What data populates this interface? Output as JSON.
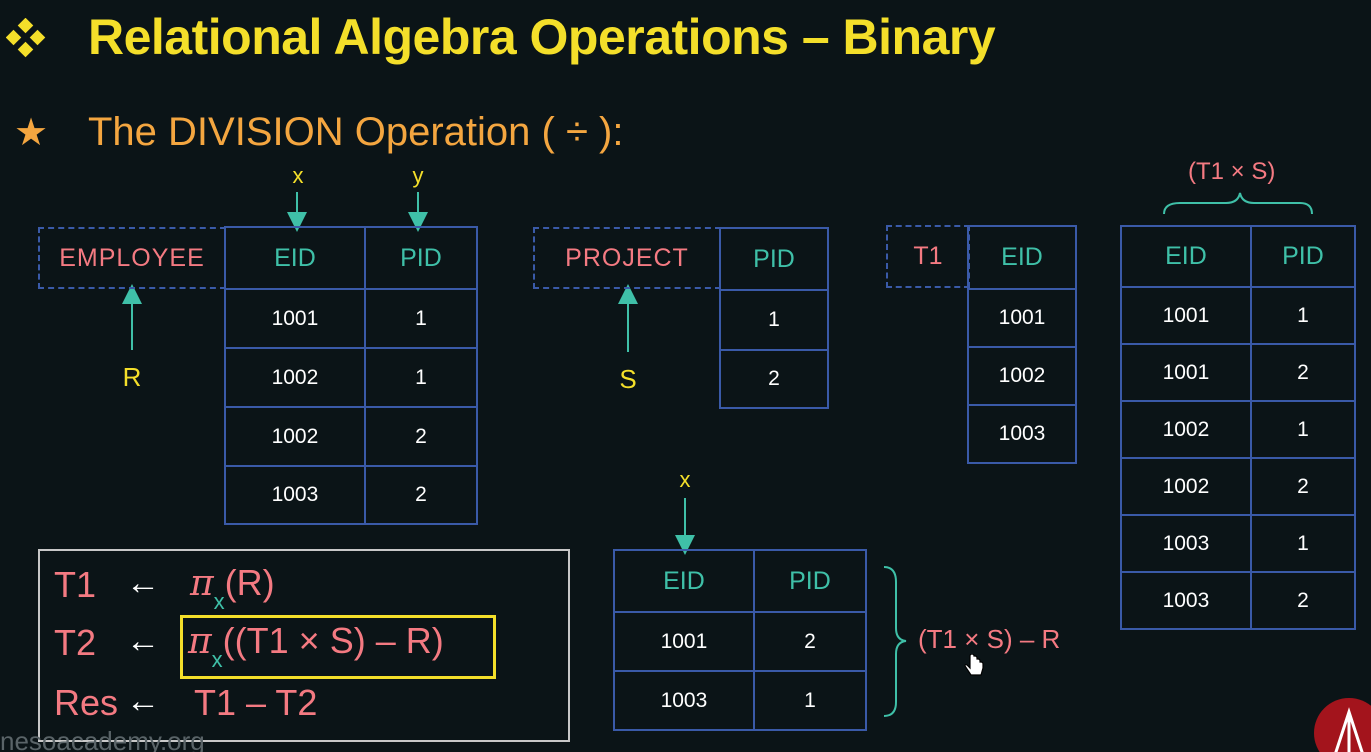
{
  "title": "Relational Algebra Operations – Binary",
  "subtitle": "The DIVISION Operation ( ÷ ):",
  "labels": {
    "x_top": "x",
    "y_top": "y",
    "r": "R",
    "s": "S",
    "x_result": "x",
    "t1xs": "(T1 × S)"
  },
  "employee": {
    "name": "EMPLOYEE",
    "headers": [
      "EID",
      "PID"
    ],
    "rows": [
      [
        "1001",
        "1"
      ],
      [
        "1002",
        "1"
      ],
      [
        "1002",
        "2"
      ],
      [
        "1003",
        "2"
      ]
    ]
  },
  "project": {
    "name": "PROJECT",
    "headers": [
      "PID"
    ],
    "rows": [
      [
        "1"
      ],
      [
        "2"
      ]
    ]
  },
  "t1": {
    "name": "T1",
    "headers": [
      "EID"
    ],
    "rows": [
      [
        "1001"
      ],
      [
        "1002"
      ],
      [
        "1003"
      ]
    ]
  },
  "t1xs_table": {
    "headers": [
      "EID",
      "PID"
    ],
    "rows": [
      [
        "1001",
        "1"
      ],
      [
        "1001",
        "2"
      ],
      [
        "1002",
        "1"
      ],
      [
        "1002",
        "2"
      ],
      [
        "1003",
        "1"
      ],
      [
        "1003",
        "2"
      ]
    ]
  },
  "diff_table": {
    "headers": [
      "EID",
      "PID"
    ],
    "rows": [
      [
        "1001",
        "2"
      ],
      [
        "1003",
        "1"
      ]
    ]
  },
  "diff_annotation": "(T1 × S) – R",
  "formulas": {
    "row1": {
      "lhs": "T1",
      "arrow": "←",
      "pi": "π",
      "sub": "x",
      "rest": "(R)"
    },
    "row2": {
      "lhs": "T2",
      "arrow": "←",
      "pi": "π",
      "sub": "x",
      "rest": "((T1 × S) – R)"
    },
    "row3": {
      "lhs": "Res",
      "arrow": "←",
      "rest": "T1 – T2"
    }
  },
  "watermark": "nesoacademy.org"
}
